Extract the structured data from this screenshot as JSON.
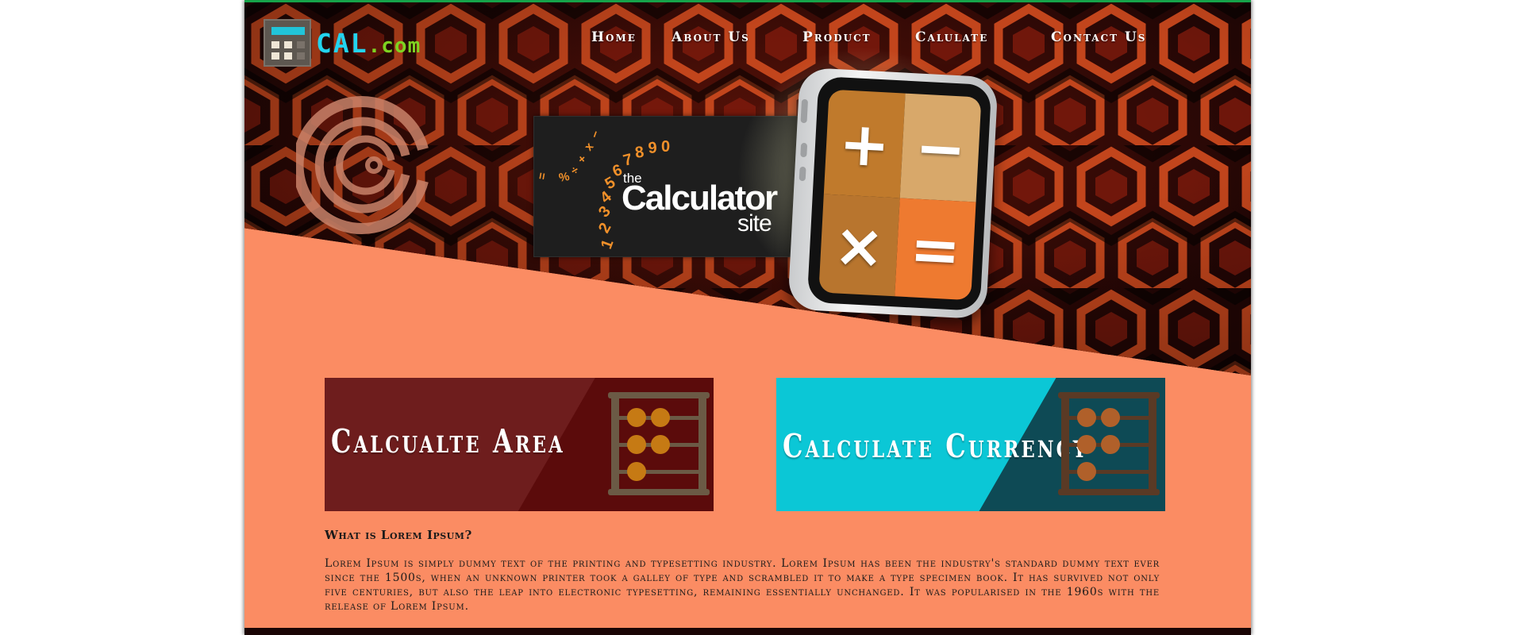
{
  "logo": {
    "text": "CAL",
    "suffix": ".com",
    "icon": "calculator-icon"
  },
  "nav": {
    "items": [
      {
        "label": "Home"
      },
      {
        "label": "About Us"
      },
      {
        "label": "Product"
      },
      {
        "label": "Calulate"
      },
      {
        "label": "Contact Us"
      }
    ]
  },
  "banner": {
    "the": "the",
    "main": "Calculator",
    "site": "site",
    "digits": "1 2 3 4 5 6 7 8 9 0",
    "symbols": "= % ÷ + x −"
  },
  "calculator": {
    "keys": [
      "+",
      "−",
      "×",
      "="
    ]
  },
  "cards": {
    "area": {
      "title": "Calcualte Area",
      "icon": "abacus-icon"
    },
    "currency": {
      "title": "Calculate Currency",
      "icon": "abacus-icon"
    }
  },
  "about": {
    "heading": "What is Lorem Ipsum?",
    "body": "Lorem Ipsum is simply dummy text of the printing and typesetting industry. Lorem Ipsum has been the industry's standard dummy text ever since the 1500s, when an unknown printer took a galley of type and scrambled it to make a type specimen book. It has survived not only five centuries, but also the leap into electronic typesetting, remaining essentially unchanged. It was popularised in the 1960s with the release of Lorem Ipsum."
  },
  "colors": {
    "page_bg": "#fb8c63",
    "accent_cyan": "#22d3ee",
    "accent_green": "#7ed321",
    "area_card": "#6e1d1d",
    "currency_card": "#0bc7d6"
  }
}
